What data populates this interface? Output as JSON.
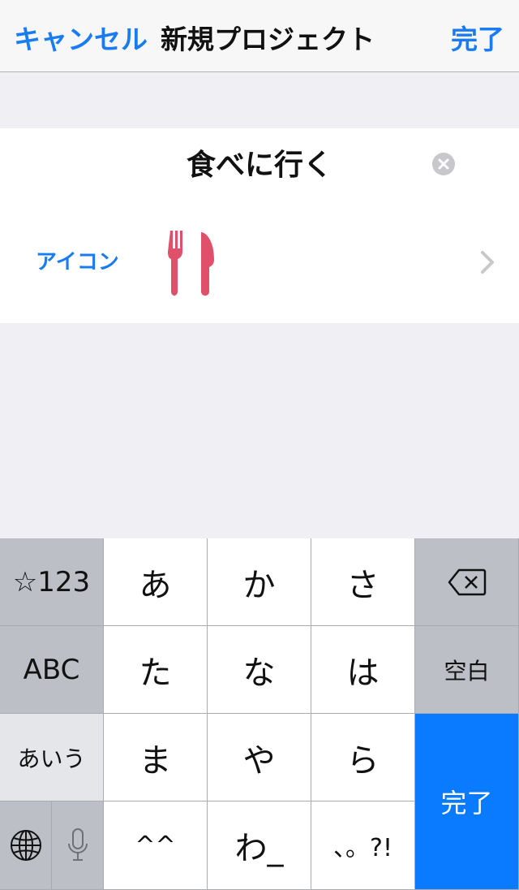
{
  "navbar": {
    "cancel_label": "キャンセル",
    "title": "新規プロジェクト",
    "done_label": "完了"
  },
  "form": {
    "project_name": "食べに行く",
    "icon_label": "アイコン",
    "icon_name": "fork-knife-icon",
    "icon_color": "#e0506a"
  },
  "keyboard": {
    "mode_key": "☆123",
    "abc_key": "ABC",
    "kana_key": "あいう",
    "row1": [
      "あ",
      "か",
      "さ"
    ],
    "row2": [
      "た",
      "な",
      "は"
    ],
    "row3": [
      "ま",
      "や",
      "ら"
    ],
    "row4": [
      "^^",
      "わ_",
      "、。?!"
    ],
    "space_key": "空白",
    "done_key": "完了",
    "accent_color": "#0a7bff"
  },
  "colors": {
    "tint": "#1a7cf2",
    "background": "#efeff4"
  }
}
